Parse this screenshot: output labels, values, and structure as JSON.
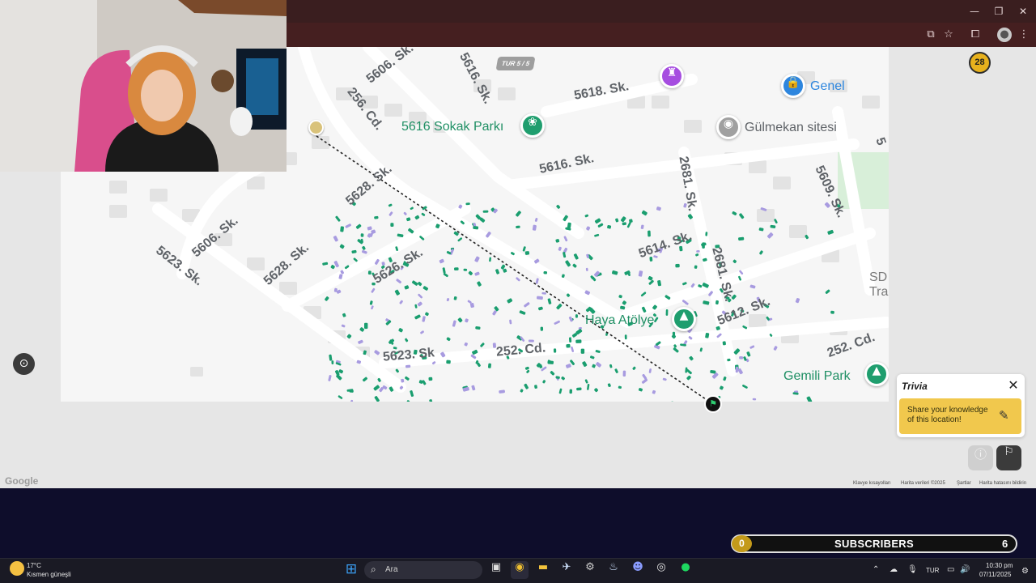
{
  "browser": {
    "window_controls": [
      "—",
      "❐",
      "✕"
    ],
    "icons": [
      "screen-cast-icon",
      "star-icon",
      "extensions-icon",
      "profile-icon",
      "more-icon"
    ]
  },
  "map": {
    "round_badge": "TUR 5 / 5",
    "level": "28",
    "streets": [
      "5606. Sk.",
      "5616. Sk.",
      "5618. Sk.",
      "256. Cd.",
      "5628. Sk.",
      "5616. Sk.",
      "2681. Sk.",
      "5609. Sk.",
      "5606. Sk.",
      "5623. Sk.",
      "5628. Sk.",
      "5626. Sk.",
      "5614. Sk.",
      "2681. Sk.",
      "5612. Sk.",
      "5623. Sk",
      "252. Cd.",
      "252. Cd.",
      "5"
    ],
    "pois": {
      "park": "5616 Sokak Parkı",
      "site": "Gülmekan sitesi",
      "genel": "Genel",
      "atolye": "Haya Atölye",
      "gemili": "Gemili Park",
      "sd_1": "SD",
      "sd_2": "Tra"
    },
    "google": "Google",
    "attribution": [
      "Klavye kısayolları",
      "Harita verileri ©2025",
      "Şartlar",
      "Harita hatasını bildirin"
    ]
  },
  "trivia": {
    "title": "Trivia",
    "prompt": "Share your knowledge of this location!"
  },
  "overlay": {
    "subs_current": "0",
    "subs_label": "SUBSCRIBERS",
    "subs_goal": "6"
  },
  "taskbar": {
    "weather_temp": "17°C",
    "weather_desc": "Kısmen güneşli",
    "search_placeholder": "Ara",
    "language": "TUR",
    "time": "10:30 pm",
    "date": "07/11/2025"
  },
  "colors": {
    "guess_green": "#1a9e6f",
    "guess_purple": "#a89be0",
    "trivia_yellow": "#f1c84d",
    "chrome_title": "#3a1e1f",
    "overlay_bg": "#0e0d2b"
  }
}
